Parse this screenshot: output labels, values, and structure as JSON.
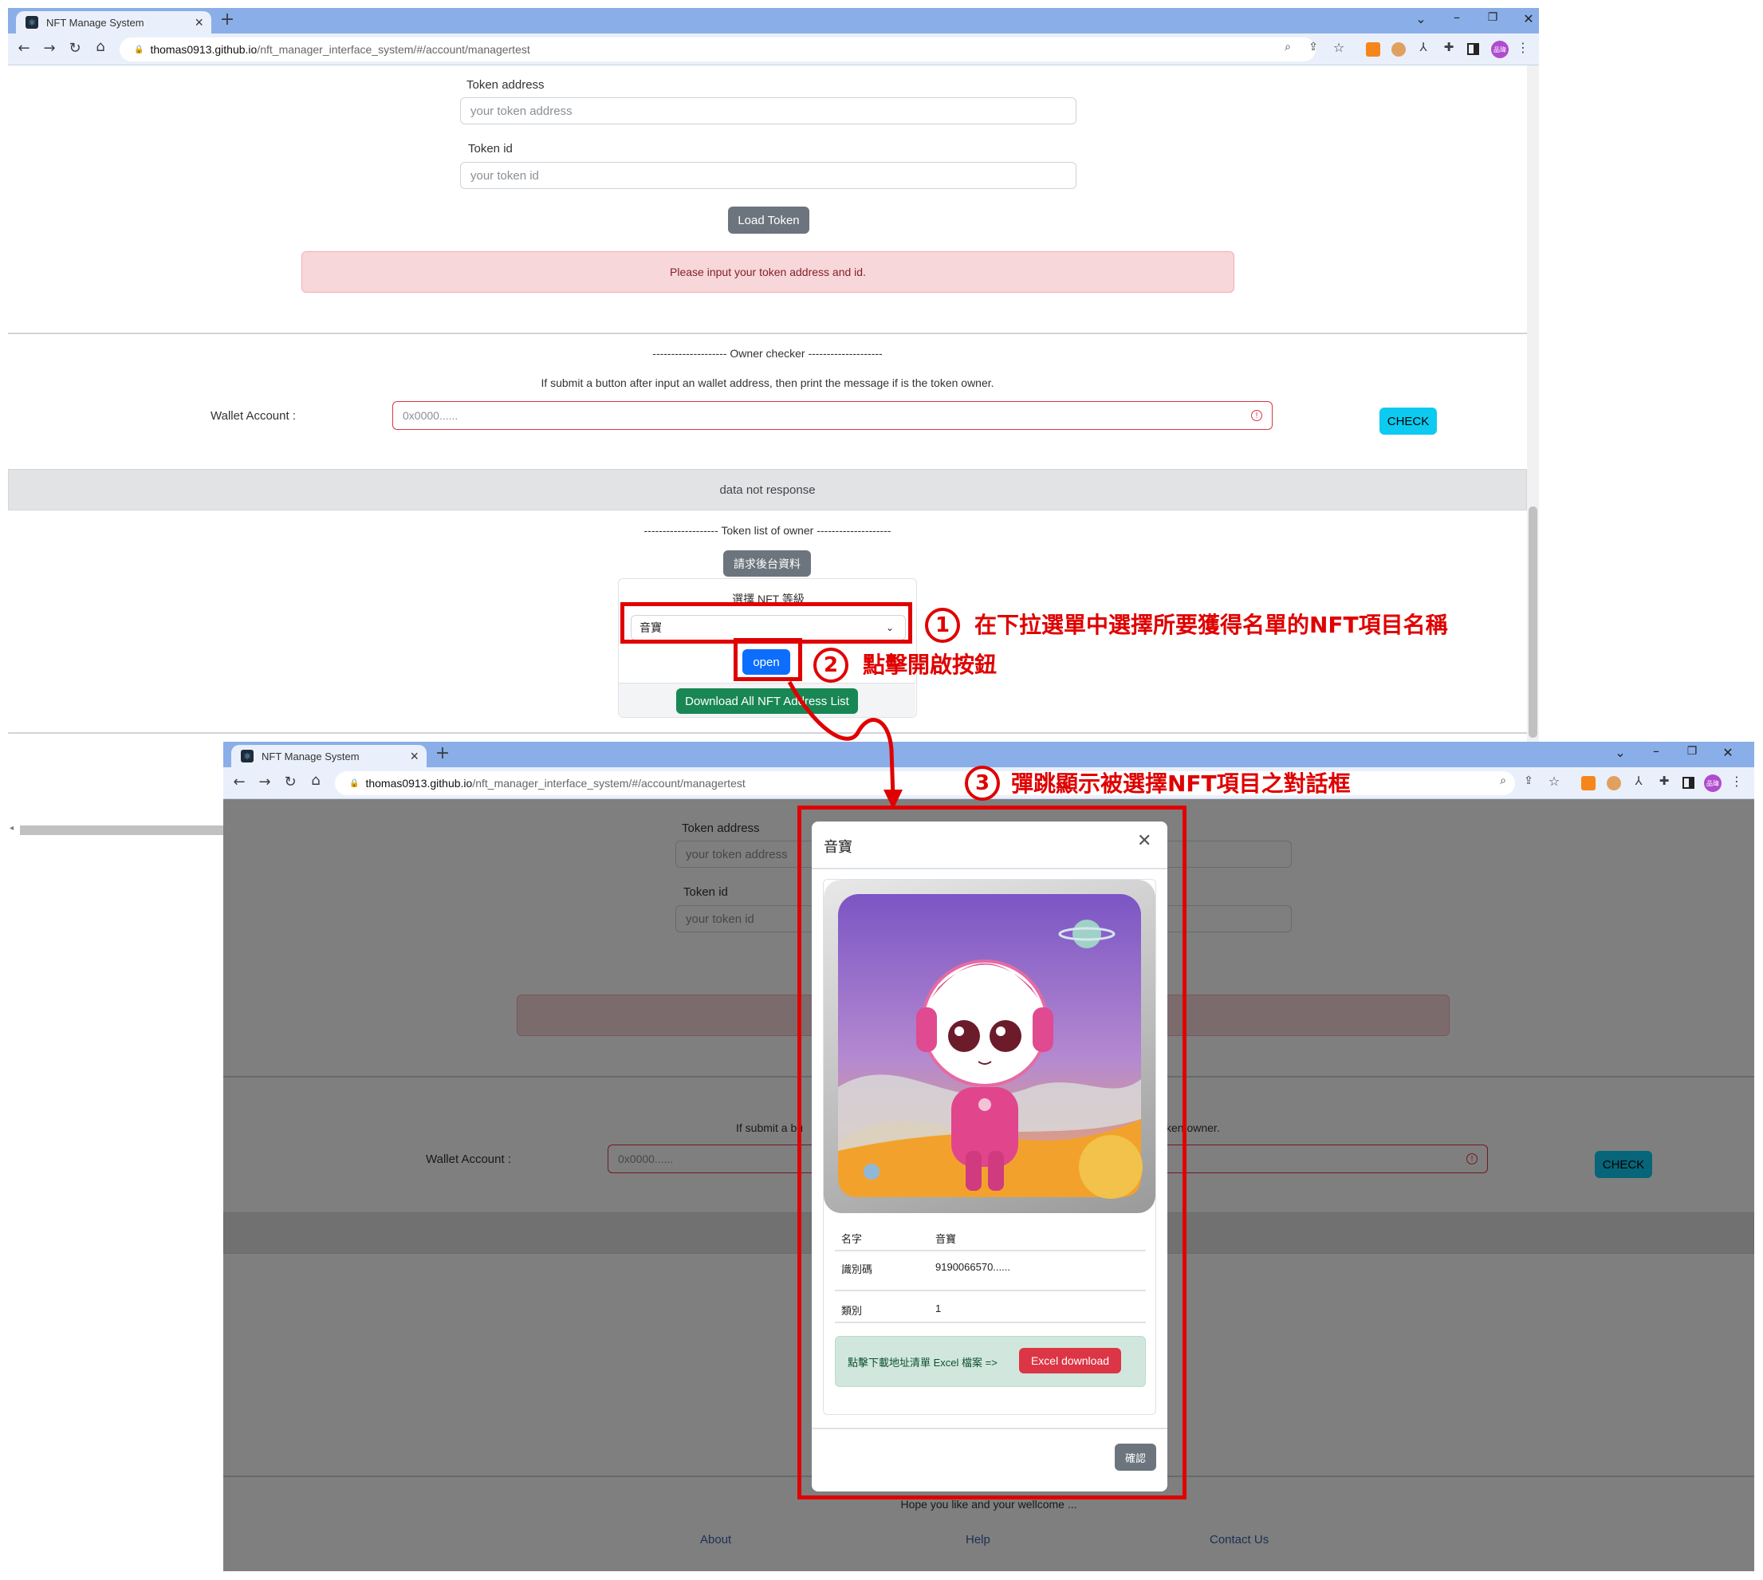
{
  "browser": {
    "tab_title": "NFT Manage System",
    "new_tab": "+",
    "close_tab": "×",
    "url_host": "thomas0913.github.io",
    "url_path": "/nft_manager_interface_system/#/account/managertest",
    "avatar_text": "品瑋",
    "window_controls": [
      "⌄",
      "–",
      "❐",
      "✕"
    ]
  },
  "form": {
    "token_address_label": "Token address",
    "token_address_placeholder": "your token address",
    "token_id_label": "Token id",
    "token_id_placeholder": "your token id",
    "load_button": "Load Token",
    "alert": "Please input your token address and id."
  },
  "owner_checker": {
    "heading": "-------------------- Owner checker --------------------",
    "description": "If submit a button after input an wallet address, then print the message if is the token owner.",
    "wallet_label": "Wallet Account :",
    "wallet_placeholder": "0x0000......",
    "check_button": "CHECK",
    "response": "data not response"
  },
  "token_list": {
    "heading": "-------------------- Token list of owner --------------------",
    "request_button": "請求後台資料",
    "select_label": "選擇 NFT 等級",
    "selected_value": "音寶",
    "open_button": "open",
    "download_button": "Download All NFT Address List"
  },
  "annotations": {
    "step1_num": "1",
    "step1": "在下拉選單中選擇所要獲得名單的NFT項目名稱",
    "step2_num": "2",
    "step2": "點擊開啟按鈕",
    "step3_num": "3",
    "step3": "彈跳顯示被選擇NFT項目之對話框"
  },
  "modal": {
    "title": "音寶",
    "rows": [
      {
        "key": "名字",
        "value": "音寶"
      },
      {
        "key": "識別碼",
        "value": "9190066570......"
      },
      {
        "key": "類別",
        "value": "1"
      }
    ],
    "download_hint": "點擊下載地址清單 Excel 檔案 =>",
    "excel_button": "Excel download",
    "confirm_button": "確認"
  },
  "footer": {
    "tagline": "Hope you like and your wellcome ...",
    "links": [
      "About",
      "Help",
      "Contact Us"
    ]
  },
  "colors": {
    "annotation_red": "#e00000",
    "chrome_blue": "#8aaee8",
    "primary": "#0d6efd",
    "success": "#198754",
    "danger": "#dc3545",
    "info": "#0dcaf0"
  }
}
